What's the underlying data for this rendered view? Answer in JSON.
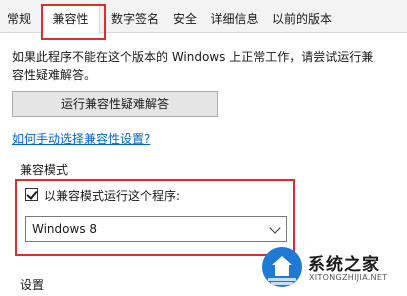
{
  "tabs": [
    {
      "label": "常规",
      "active": false
    },
    {
      "label": "兼容性",
      "active": true
    },
    {
      "label": "数字签名",
      "active": false
    },
    {
      "label": "安全",
      "active": false
    },
    {
      "label": "详细信息",
      "active": false
    },
    {
      "label": "以前的版本",
      "active": false
    }
  ],
  "intro_text": {
    "line1": "如果此程序不能在这个版本的 Windows 上正常工作，请尝试运行兼",
    "line2": "容性疑难解答。"
  },
  "troubleshooter_button": "运行兼容性疑难解答",
  "manual_link": "如何手动选择兼容性设置?",
  "compat_mode": {
    "group_label": "兼容模式",
    "checkbox_label": "以兼容模式运行这个程序:",
    "checked": true,
    "selected_os": "Windows 8"
  },
  "settings_group_label": "设置",
  "watermark": {
    "title": "系统之家",
    "url": "XITONGZHIJIA.NET"
  },
  "colors": {
    "highlight": "#d9302b",
    "link": "#0066cc"
  }
}
